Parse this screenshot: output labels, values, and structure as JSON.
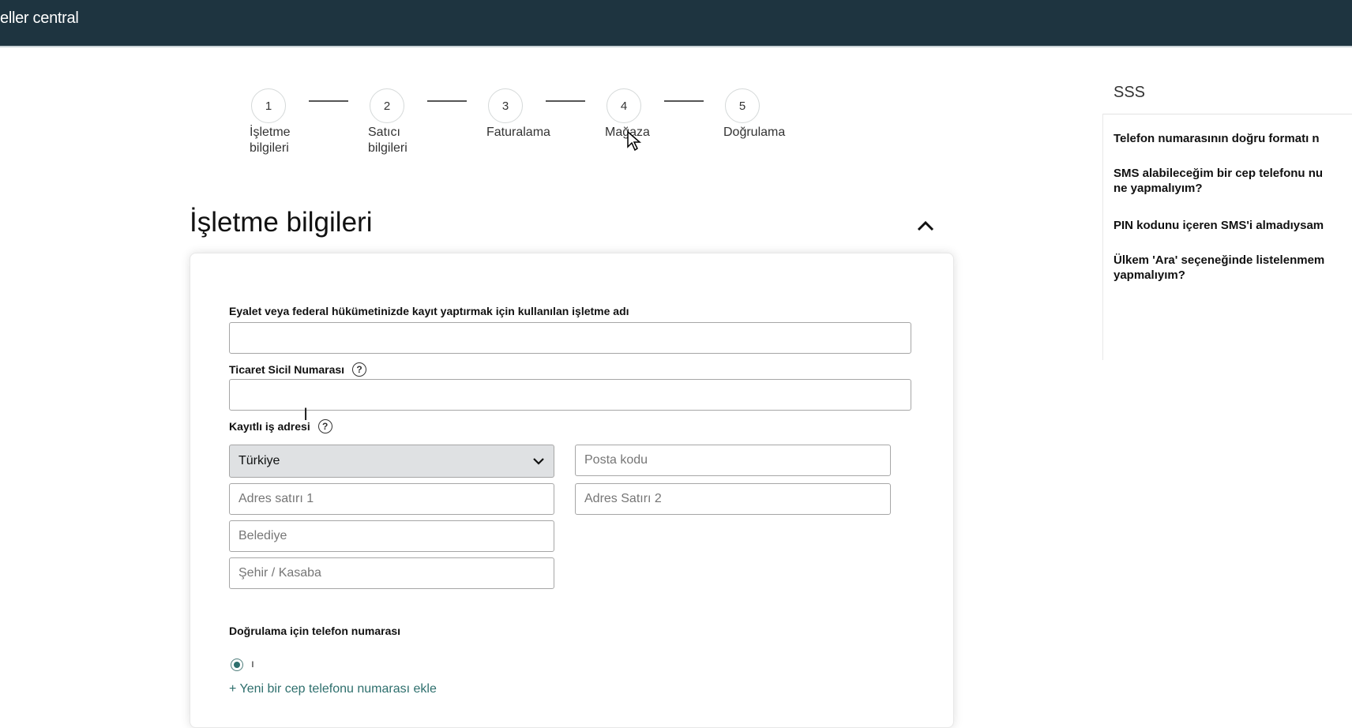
{
  "header": {
    "brand": "eller central"
  },
  "stepper": {
    "steps": [
      {
        "num": "1",
        "label_line1": "İşletme",
        "label_line2": "bilgileri"
      },
      {
        "num": "2",
        "label_line1": "Satıcı",
        "label_line2": "bilgileri"
      },
      {
        "num": "3",
        "label_line1": "Faturalama",
        "label_line2": ""
      },
      {
        "num": "4",
        "label_line1": "Mağaza",
        "label_line2": ""
      },
      {
        "num": "5",
        "label_line1": "Doğrulama",
        "label_line2": ""
      }
    ]
  },
  "section": {
    "title": "İşletme bilgileri"
  },
  "form": {
    "business_name_label": "Eyalet veya federal hükümetinizde kayıt yaptırmak için kullanılan işletme adı",
    "business_name_value": "",
    "trade_registry_label": "Ticaret Sicil Numarası",
    "trade_registry_value": "",
    "address_label": "Kayıtlı iş adresi",
    "country_selected": "Türkiye",
    "postal_placeholder": "Posta kodu",
    "address1_placeholder": "Adres satırı 1",
    "address2_placeholder": "Adres Satırı 2",
    "municipality_placeholder": "Belediye",
    "city_placeholder": "Şehir / Kasaba",
    "phone_label": "Doğrulama için telefon numarası",
    "phone_option_text": "ı",
    "add_phone_link": "+ Yeni bir cep telefonu numarası ekle"
  },
  "faq": {
    "title": "SSS",
    "items": [
      {
        "line1": "Telefon numarasının doğru formatı n",
        "line2": ""
      },
      {
        "line1": "SMS alabileceğim bir cep telefonu nu",
        "line2": "ne yapmalıyım?"
      },
      {
        "line1": "PIN kodunu içeren SMS'i almadıysam",
        "line2": ""
      },
      {
        "line1": "Ülkem 'Ara' seçeneğinde listelenmem",
        "line2": "yapmalıyım?"
      }
    ]
  },
  "icons": {
    "help": "question-circle-icon",
    "collapse": "chevron-up-icon",
    "dropdown": "chevron-down-icon"
  },
  "colors": {
    "header_bg": "#1e3440",
    "link": "#2e6f6d",
    "select_bg": "#dfe1e3"
  }
}
